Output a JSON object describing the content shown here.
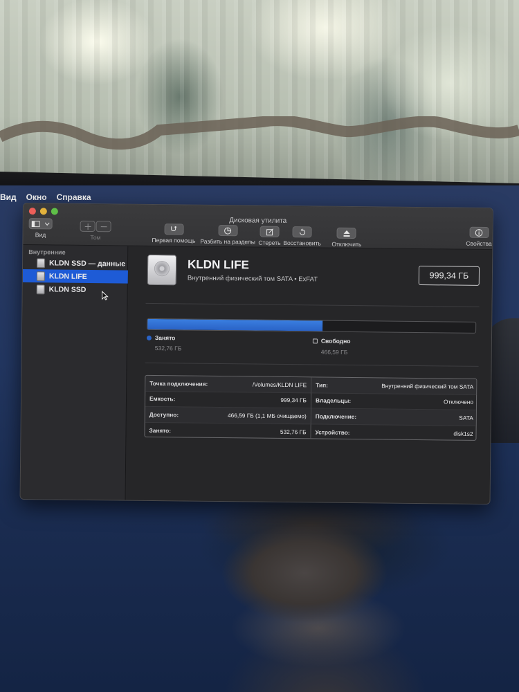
{
  "menubar": {
    "items": [
      "Вид",
      "Окно",
      "Справка"
    ]
  },
  "window": {
    "title": "Дисковая утилита"
  },
  "toolbar": {
    "view_label": "Вид",
    "volume_label": "Том",
    "first_aid_label": "Первая помощь",
    "partition_label": "Разбить на разделы",
    "erase_label": "Стереть",
    "restore_label": "Восстановить",
    "unmount_label": "Отключить",
    "info_label": "Свойства"
  },
  "sidebar": {
    "section_title": "Внутренние",
    "items": [
      {
        "label": "KLDN SSD — данные",
        "selected": false
      },
      {
        "label": "KLDN LIFE",
        "selected": true
      },
      {
        "label": "KLDN SSD",
        "selected": false
      }
    ]
  },
  "volume": {
    "name": "KLDN LIFE",
    "description": "Внутренний физический том SATA • ExFAT",
    "capacity": "999,34 ГБ",
    "used_fraction": 0.533
  },
  "usage": {
    "used_label": "Занято",
    "used_value": "532,76 ГБ",
    "free_label": "Свободно",
    "free_value": "466,59 ГБ",
    "used_color": "#2a63c6",
    "free_color": "#1c1c1e"
  },
  "info": {
    "left": [
      {
        "key": "Точка подключения:",
        "value": "/Volumes/KLDN LIFE"
      },
      {
        "key": "Емкость:",
        "value": "999,34 ГБ"
      },
      {
        "key": "Доступно:",
        "value": "466,59 ГБ (1,1 МБ очищаемо)"
      },
      {
        "key": "Занято:",
        "value": "532,76 ГБ"
      }
    ],
    "right": [
      {
        "key": "Тип:",
        "value": "Внутренний физический том SATA"
      },
      {
        "key": "Владельцы:",
        "value": "Отключено"
      },
      {
        "key": "Подключение:",
        "value": "SATA"
      },
      {
        "key": "Устройство:",
        "value": "disk1s2"
      }
    ]
  },
  "accent_color": "#1e5bd6"
}
